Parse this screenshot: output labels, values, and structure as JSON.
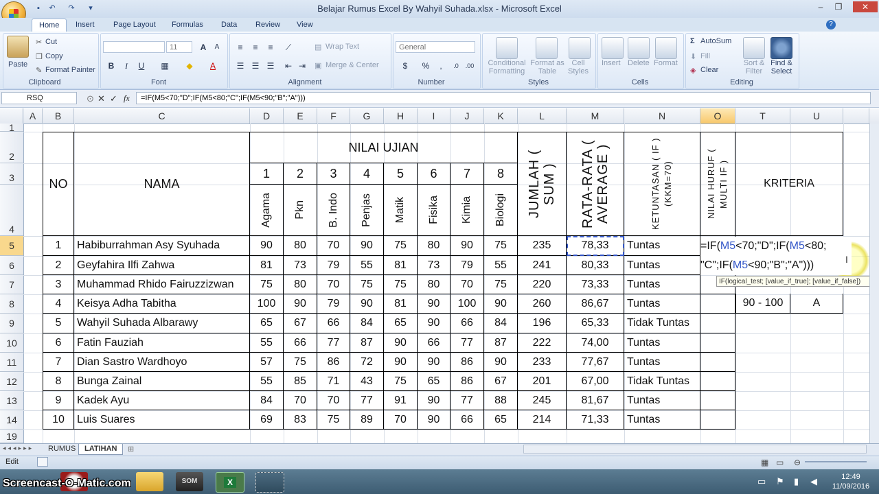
{
  "window": {
    "title": "Belajar Rumus Excel By Wahyil Suhada.xlsx - Microsoft Excel",
    "controls": {
      "minimize": "–",
      "restore": "❐",
      "close": "✕"
    }
  },
  "ribbon_tabs": [
    "Home",
    "Insert",
    "Page Layout",
    "Formulas",
    "Data",
    "Review",
    "View"
  ],
  "clipboard": {
    "paste": "Paste",
    "cut": "Cut",
    "copy": "Copy",
    "format_painter": "Format Painter",
    "label": "Clipboard"
  },
  "font": {
    "name": "",
    "size": "11",
    "label": "Font",
    "bold": "B",
    "italic": "I",
    "underline": "U",
    "grow": "A",
    "shrink": "A"
  },
  "alignment": {
    "wrap_text": "Wrap Text",
    "merge_center": "Merge & Center",
    "label": "Alignment"
  },
  "number": {
    "format": "General",
    "percent": "%",
    "comma": ",",
    "label": "Number"
  },
  "styles": {
    "conditional": "Conditional Formatting",
    "as_table": "Format as Table",
    "cell_styles": "Cell Styles",
    "label": "Styles"
  },
  "cells": {
    "insert": "Insert",
    "delete": "Delete",
    "format": "Format",
    "label": "Cells"
  },
  "editing": {
    "autosum": "AutoSum",
    "fill": "Fill",
    "clear": "Clear",
    "sort_filter": "Sort & Filter",
    "find_select": "Find & Select",
    "label": "Editing"
  },
  "formula_bar": {
    "name_box": "RSQ",
    "fx": "fx",
    "formula": "=IF(M5<70;\"D\";IF(M5<80;\"C\";IF(M5<90;\"B\";\"A\")))"
  },
  "columns": [
    "A",
    "B",
    "C",
    "D",
    "E",
    "F",
    "G",
    "H",
    "I",
    "J",
    "K",
    "L",
    "M",
    "N",
    "O",
    "T",
    "U"
  ],
  "rows": [
    "1",
    "2",
    "3",
    "4",
    "5",
    "6",
    "7",
    "8",
    "9",
    "10",
    "11",
    "12",
    "13",
    "14",
    "19"
  ],
  "table": {
    "no": "NO",
    "nama": "NAMA",
    "nilai_ujian": "NILAI UJIAN",
    "subject_numbers": [
      "1",
      "2",
      "3",
      "4",
      "5",
      "6",
      "7",
      "8"
    ],
    "subjects": [
      "Agama",
      "Pkn",
      "B. Indo",
      "Penjas",
      "Matik",
      "Fisika",
      "Kimia",
      "Biologi"
    ],
    "jumlah": "JUMLAH ( SUM )",
    "rata": "RATA-RATA ( AVERAGE )",
    "ketuntasan": "KETUNTASAN ( IF ) (KKM=70)",
    "nilai_huruf": "NILAI HURUF ( MULTI IF )",
    "students": [
      {
        "no": "1",
        "nama": "Habiburrahman Asy Syuhada",
        "scores": [
          "90",
          "80",
          "70",
          "90",
          "75",
          "80",
          "90",
          "75"
        ],
        "jumlah": "235",
        "rata": "78,33",
        "status": "Tuntas"
      },
      {
        "no": "2",
        "nama": "Geyfahira Ilfi Zahwa",
        "scores": [
          "81",
          "73",
          "79",
          "55",
          "81",
          "73",
          "79",
          "55"
        ],
        "jumlah": "241",
        "rata": "80,33",
        "status": "Tuntas"
      },
      {
        "no": "3",
        "nama": "Muhammad Rhido Fairuzzizwan",
        "scores": [
          "75",
          "80",
          "70",
          "75",
          "75",
          "80",
          "70",
          "75"
        ],
        "jumlah": "220",
        "rata": "73,33",
        "status": "Tuntas"
      },
      {
        "no": "4",
        "nama": "Keisya Adha Tabitha",
        "scores": [
          "100",
          "90",
          "79",
          "90",
          "81",
          "90",
          "100",
          "90"
        ],
        "jumlah": "260",
        "rata": "86,67",
        "status": "Tuntas"
      },
      {
        "no": "5",
        "nama": "Wahyil Suhada Albarawy",
        "scores": [
          "65",
          "67",
          "66",
          "84",
          "65",
          "90",
          "66",
          "84"
        ],
        "jumlah": "196",
        "rata": "65,33",
        "status": "Tidak Tuntas"
      },
      {
        "no": "6",
        "nama": "Fatin Fauziah",
        "scores": [
          "55",
          "66",
          "77",
          "87",
          "90",
          "66",
          "77",
          "87"
        ],
        "jumlah": "222",
        "rata": "74,00",
        "status": "Tuntas"
      },
      {
        "no": "7",
        "nama": "Dian Sastro Wardhoyo",
        "scores": [
          "57",
          "75",
          "86",
          "72",
          "90",
          "90",
          "86",
          "90"
        ],
        "jumlah": "233",
        "rata": "77,67",
        "status": "Tuntas"
      },
      {
        "no": "8",
        "nama": "Bunga Zainal",
        "scores": [
          "55",
          "85",
          "71",
          "43",
          "75",
          "65",
          "86",
          "67"
        ],
        "jumlah": "201",
        "rata": "67,00",
        "status": "Tidak Tuntas"
      },
      {
        "no": "9",
        "nama": "Kadek Ayu",
        "scores": [
          "84",
          "70",
          "70",
          "77",
          "91",
          "90",
          "77",
          "88"
        ],
        "jumlah": "245",
        "rata": "81,67",
        "status": "Tuntas"
      },
      {
        "no": "10",
        "nama": "Luis Suares",
        "scores": [
          "69",
          "83",
          "75",
          "89",
          "70",
          "90",
          "66",
          "65"
        ],
        "jumlah": "214",
        "rata": "71,33",
        "status": "Tuntas"
      }
    ]
  },
  "kriteria": {
    "header": "KRITERIA",
    "range": "90 - 100",
    "grade": "A"
  },
  "edit": {
    "line1_a": "=IF(",
    "line1_ref": "M5",
    "line1_b": "<70;\"D\";IF(",
    "line1_ref2": "M5",
    "line1_c": "<80;",
    "line2_a": "\"C\";IF(",
    "line2_ref": "M5",
    "line2_b": "<90;\"B\";\"A\")))",
    "tooltip": "IF(logical_test; [value_if_true]; [value_if_false])"
  },
  "sheets": [
    "RUMUS",
    "LATIHAN"
  ],
  "status": {
    "mode": "Edit"
  },
  "taskbar": {
    "watermark": "Screencast-O-Matic.com",
    "time": "12:49",
    "date": "11/09/2016"
  },
  "colors": {
    "ribbon": "#dbe7f5",
    "selection": "#3457c8",
    "ref2": "#2a7d2a",
    "active_header": "#f8c86b"
  }
}
